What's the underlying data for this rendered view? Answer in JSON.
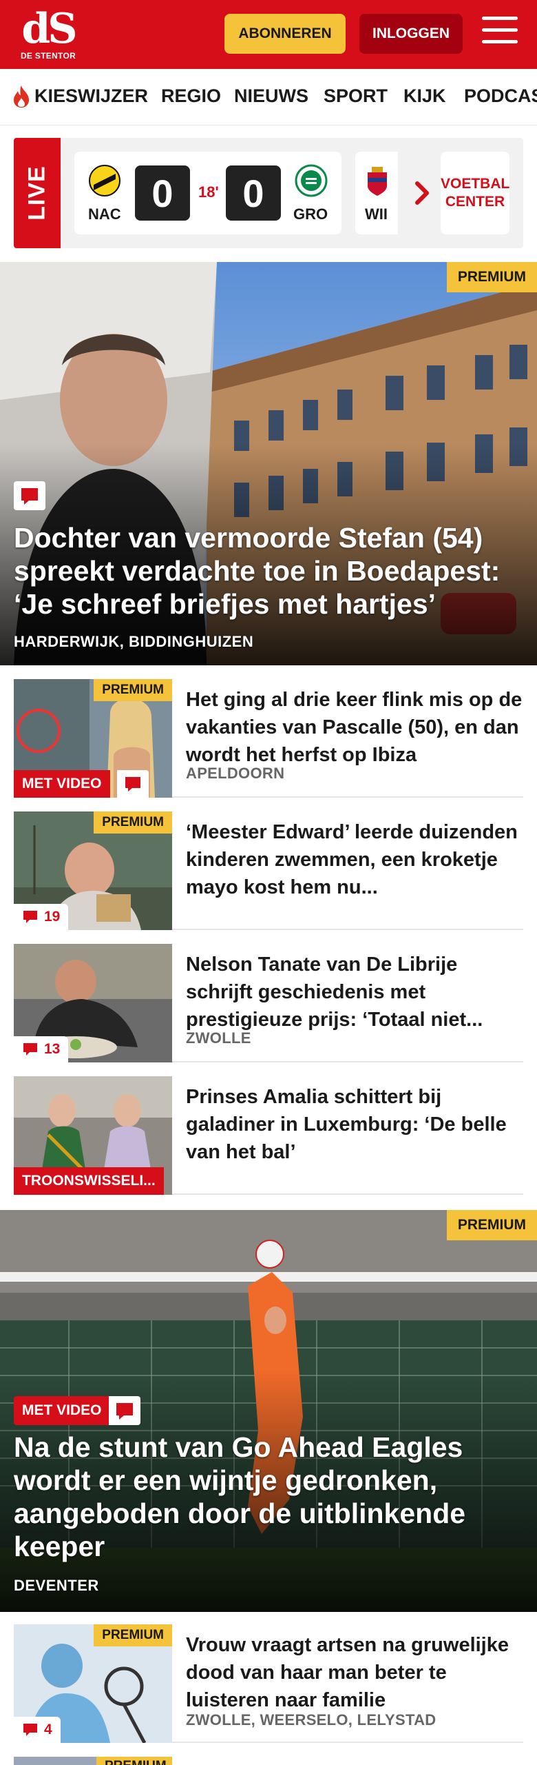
{
  "header": {
    "logo_mark": "dS",
    "logo_sub": "DE STENTOR",
    "subscribe_label": "ABONNEREN",
    "login_label": "INLOGGEN",
    "menu_icon": "hamburger-icon",
    "brand_color": "#d50e1a",
    "accent_color": "#f5c33a"
  },
  "nav": {
    "items": [
      {
        "label": "KIESWIJZER",
        "icon": "flame-icon"
      },
      {
        "label": "REGIO"
      },
      {
        "label": "NIEUWS"
      },
      {
        "label": "SPORT"
      },
      {
        "label": "KIJK"
      },
      {
        "label": "PODCAS"
      }
    ]
  },
  "live": {
    "tab_label": "LIVE",
    "match": {
      "home_team": "NAC",
      "home_score": "0",
      "minute": "18'",
      "away_score": "0",
      "away_team": "GRO"
    },
    "next_match_team": "WII",
    "more_icon": "chevron-right-icon",
    "voetbal_center_label": "VOETBAL CENTER"
  },
  "hero1": {
    "premium": "PREMIUM",
    "title": "Dochter van vermoorde Stefan (54) spreekt verdachte toe in Boedapest: ‘Je schreef briefjes met hartjes’",
    "location": "HARDERWIJK, BIDDINGHUIZEN",
    "comment_icon": "comment-icon"
  },
  "articles": [
    {
      "premium": "PREMIUM",
      "title": "Het ging al drie keer flink mis op de vakanties van Pascalle (50), en dan wordt het herfst op Ibiza",
      "location": "APELDOORN",
      "badge": "MET VIDEO",
      "comments": ""
    },
    {
      "premium": "PREMIUM",
      "title": "‘Meester Edward’ leerde duizenden kinderen zwemmen, een kroketje mayo kost hem nu...",
      "location": "",
      "badge": "",
      "comments": "19"
    },
    {
      "premium": "",
      "title": "Nelson Tanate van De Librije schrijft geschiedenis met prestigieuze prijs: ‘Totaal niet...",
      "location": "ZWOLLE",
      "badge": "",
      "comments": "13"
    },
    {
      "premium": "",
      "title": "Prinses Amalia schittert bij galadiner in Luxemburg: ‘De belle van het bal’",
      "location": "",
      "badge": "TROONSWISSELI...",
      "comments": ""
    }
  ],
  "hero2": {
    "premium": "PREMIUM",
    "video_badge": "MET VIDEO",
    "title": "Na de stunt van Go Ahead Eagles wordt er een wijntje gedronken, aangeboden door de uitblinkende keeper",
    "location": "DEVENTER"
  },
  "article5": {
    "premium": "PREMIUM",
    "title": "Vrouw vraagt artsen na gruwelijke dood van haar man beter te luisteren naar familie",
    "location": "ZWOLLE, WEERSELO, LELYSTAD",
    "comments": "4"
  },
  "article6": {
    "premium": "PREMIUM"
  }
}
